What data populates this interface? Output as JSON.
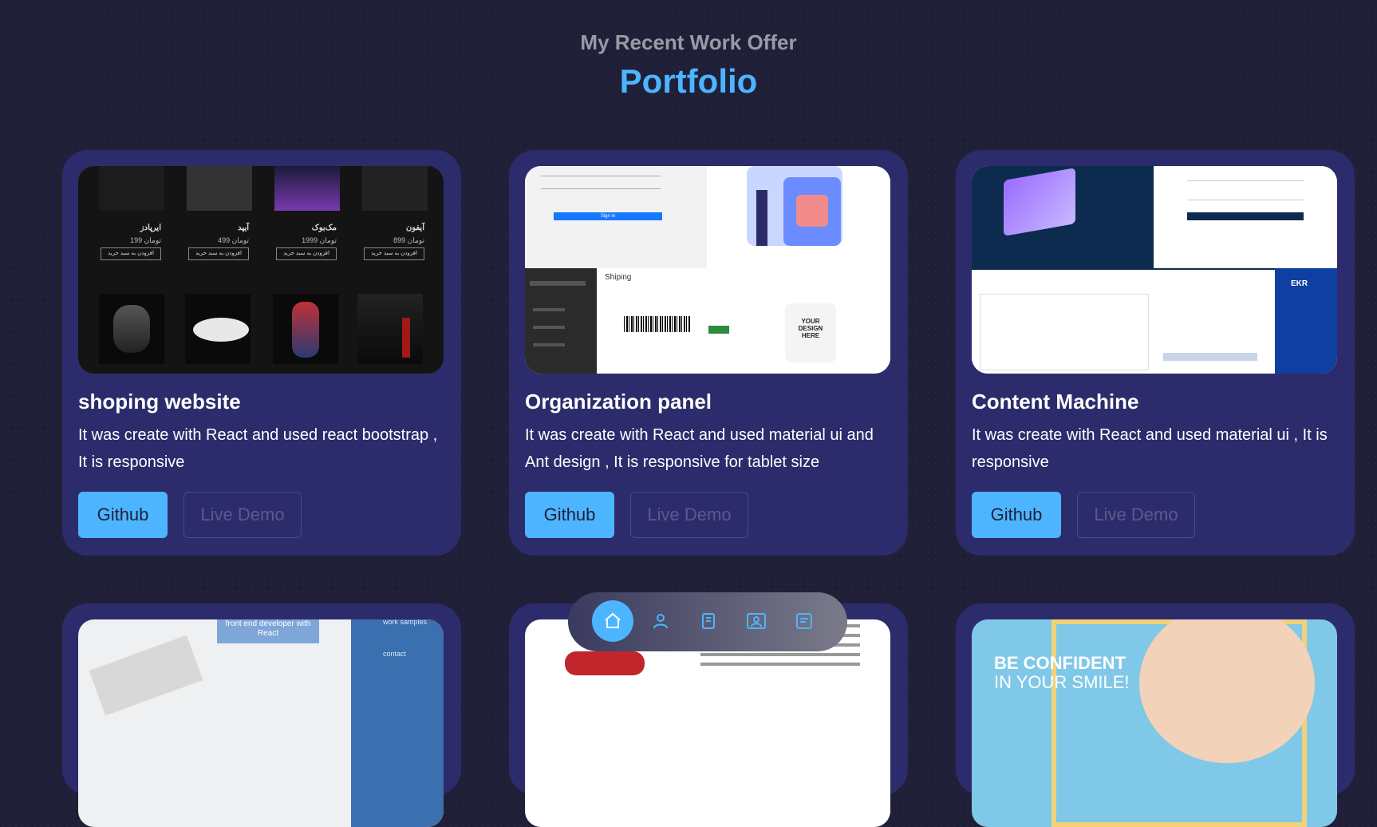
{
  "header": {
    "subtitle": "My Recent Work Offer",
    "title": "Portfolio"
  },
  "projects": [
    {
      "title": "shoping website",
      "description": "It was create with React and used react bootstrap , It is responsive",
      "github_label": "Github",
      "demo_label": "Live Demo",
      "thumbnail": {
        "products": [
          {
            "name": "آیفون",
            "price": "تومان 899",
            "button": "افزودن به سبد خرید"
          },
          {
            "name": "مک‌بوک",
            "price": "تومان 1999",
            "button": "افزودن به سبد خرید"
          },
          {
            "name": "آیپد",
            "price": "تومان 499",
            "button": "افزودن به سبد خرید"
          },
          {
            "name": "ایرپادز",
            "price": "تومان 199",
            "button": "افزودن به سبد خرید"
          }
        ]
      }
    },
    {
      "title": "Organization panel",
      "description": "It was create with React and used material ui and Ant design , It is responsive for tablet size",
      "github_label": "Github",
      "demo_label": "Live Demo",
      "thumbnail": {
        "header": "Shiping",
        "button": "Sign in",
        "tshirt_text": "YOUR DESIGN HERE"
      }
    },
    {
      "title": "Content Machine",
      "description": "It was create with React and used material ui , It is responsive",
      "github_label": "Github",
      "demo_label": "Live Demo",
      "thumbnail": {
        "brand": "EKR"
      }
    }
  ],
  "row2": [
    {
      "thumb_text_1": "front end developer with React",
      "thumb_text_2": "work samples",
      "thumb_text_3": "contact"
    },
    {
      "thumb_text_1": ""
    },
    {
      "thumb_text_1": "BE CONFIDENT",
      "thumb_text_2": "IN YOUR SMILE!"
    }
  ],
  "nav": {
    "items": [
      {
        "icon": "home-icon"
      },
      {
        "icon": "user-icon"
      },
      {
        "icon": "book-icon"
      },
      {
        "icon": "profile-card-icon"
      },
      {
        "icon": "message-icon"
      }
    ]
  },
  "colors": {
    "accent": "#4db5ff",
    "background": "#1f1f38",
    "card": "#2c2c6c"
  }
}
